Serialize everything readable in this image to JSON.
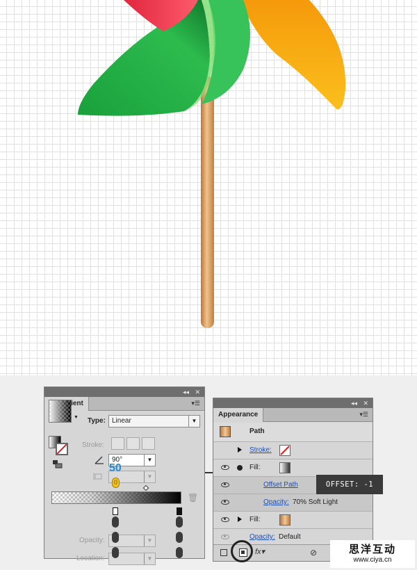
{
  "gradient_panel": {
    "title": "Gradient",
    "type_label": "Type:",
    "type_value": "Linear",
    "stroke_label": "Stroke:",
    "angle_value": "90°",
    "opacity_label": "Opacity:",
    "location_label": "Location:",
    "callout_number": "50",
    "callout_zero": "0"
  },
  "appearance_panel": {
    "title": "Appearance",
    "object_label": "Path",
    "rows": [
      {
        "label": "Stroke:"
      },
      {
        "label": "Fill:"
      },
      {
        "label": "Offset Path"
      },
      {
        "label": "Opacity:",
        "value": "70% Soft Light"
      },
      {
        "label": "Fill:"
      },
      {
        "label": "Opacity:",
        "value": "Default"
      }
    ]
  },
  "tooltip": {
    "text": "OFFSET: -1"
  },
  "watermark": {
    "chinese": "思洋互动",
    "url": "www.ciya.cn"
  },
  "colors": {
    "red_blade": "#e8304a",
    "green_blade": "#1e9e3e",
    "orange_blade": "#f7a512",
    "stick": "#d89a5c",
    "link_blue": "#1a4fb8"
  }
}
